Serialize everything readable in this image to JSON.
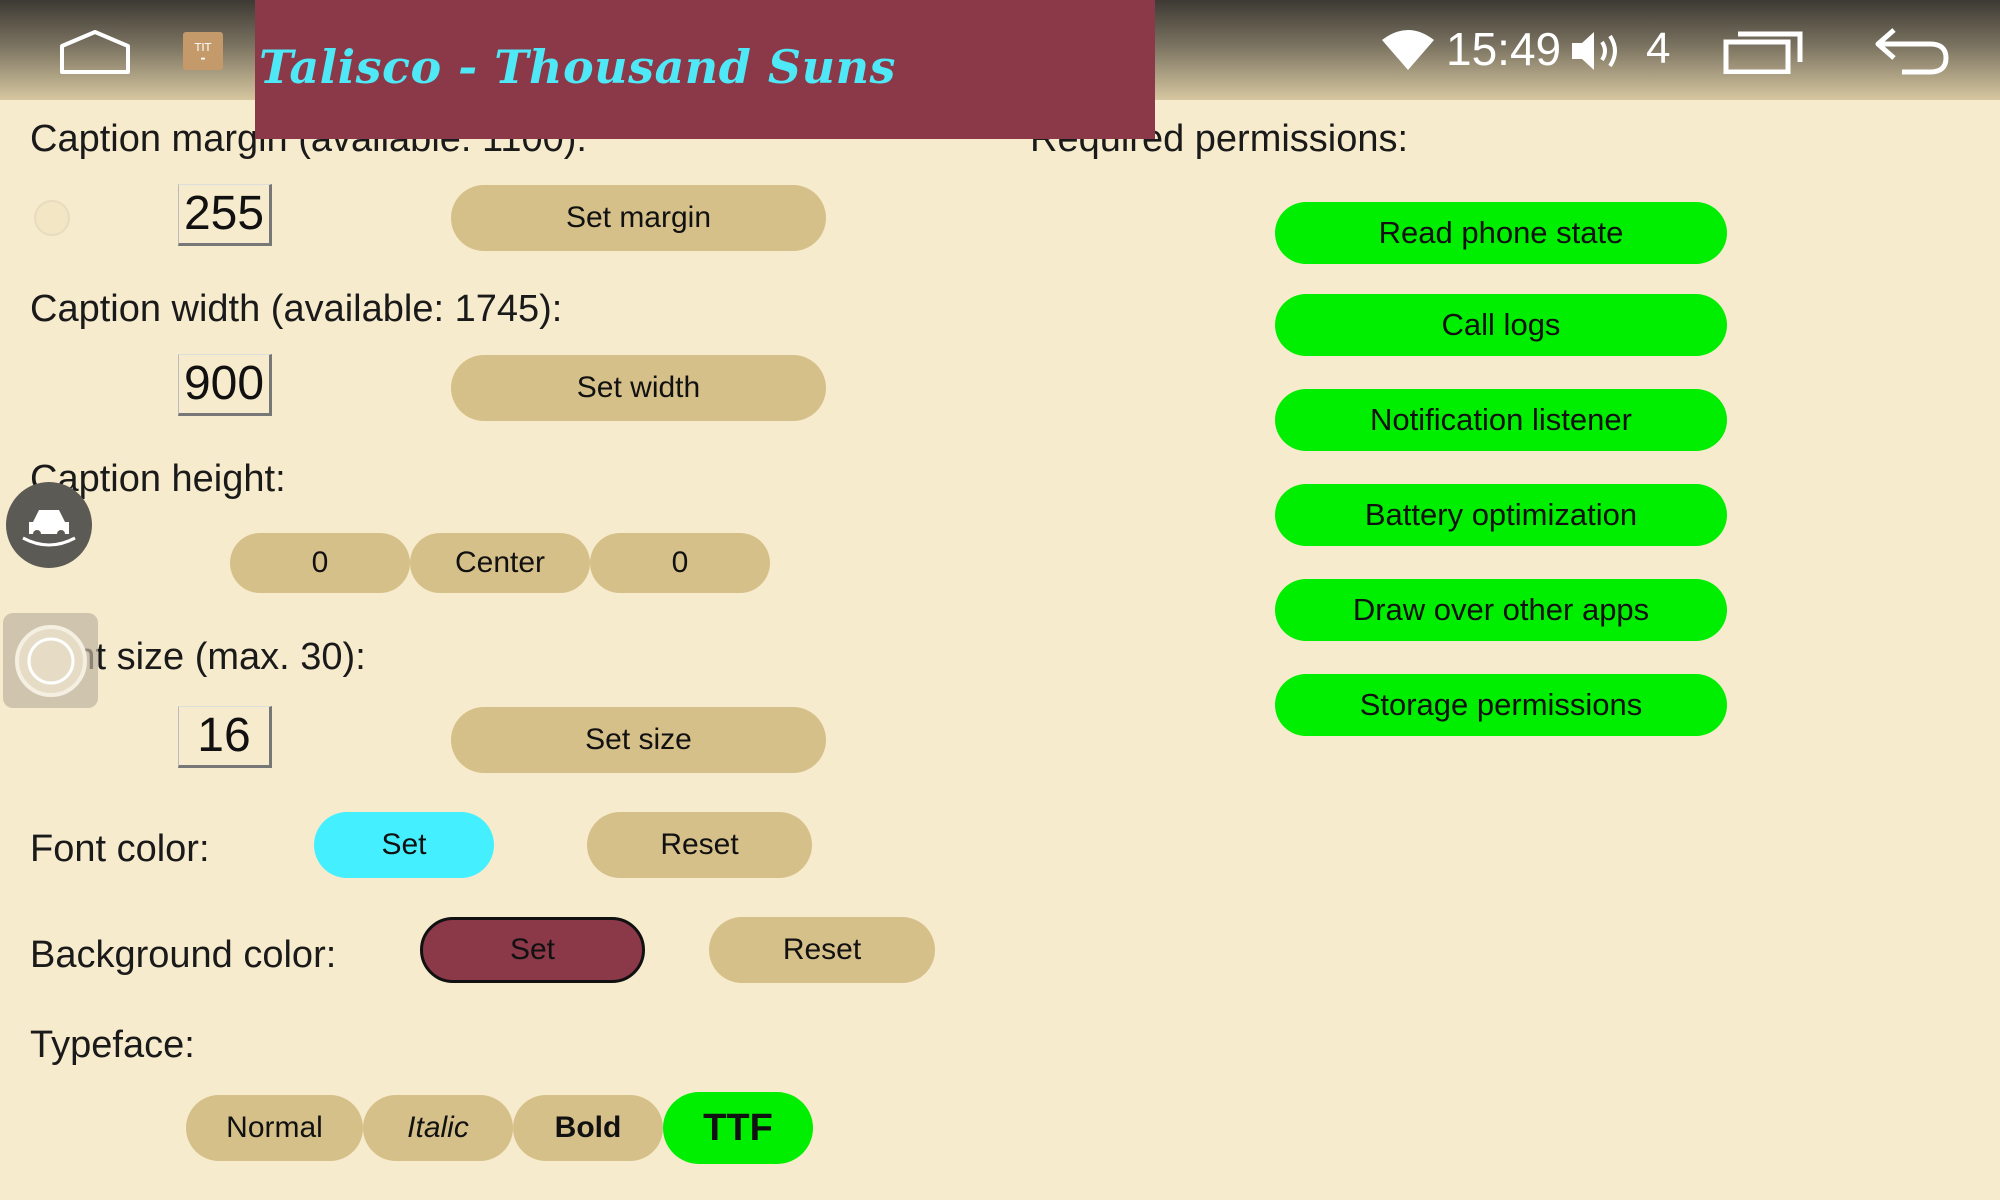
{
  "statusbar": {
    "time": "15:49",
    "volume_level": "4",
    "app_icon_text": "TIT"
  },
  "caption": {
    "text": "Talisco - Thousand Suns",
    "background_color": "#8b3848",
    "font_color": "#4fe8f6"
  },
  "caption_margin": {
    "label": "Caption margin (available: 1100):",
    "value": "255",
    "button": "Set margin"
  },
  "caption_width": {
    "label": "Caption width (available: 1745):",
    "value": "900",
    "button": "Set width"
  },
  "caption_height": {
    "label": "Caption height:",
    "buttons": [
      "0",
      "Center",
      "0"
    ]
  },
  "font_size": {
    "label": "Font size (max. 30):",
    "value": "16",
    "button": "Set size"
  },
  "font_color": {
    "label": "Font color:",
    "set": "Set",
    "reset": "Reset"
  },
  "background_color": {
    "label": "Background color:",
    "set": "Set",
    "reset": "Reset"
  },
  "typeface": {
    "label": "Typeface:",
    "options": [
      "Normal",
      "Italic",
      "Bold",
      "TTF"
    ],
    "selected": "TTF"
  },
  "permissions": {
    "title": "Required permissions:",
    "items": [
      "Read phone state",
      "Call logs",
      "Notification listener",
      "Battery optimization",
      "Draw over other apps",
      "Storage permissions"
    ]
  },
  "colors": {
    "accent_green": "#00ee00",
    "pill_tan": "#d6c08a",
    "cyan": "#44f0ff",
    "background": "#f7ebcd"
  }
}
